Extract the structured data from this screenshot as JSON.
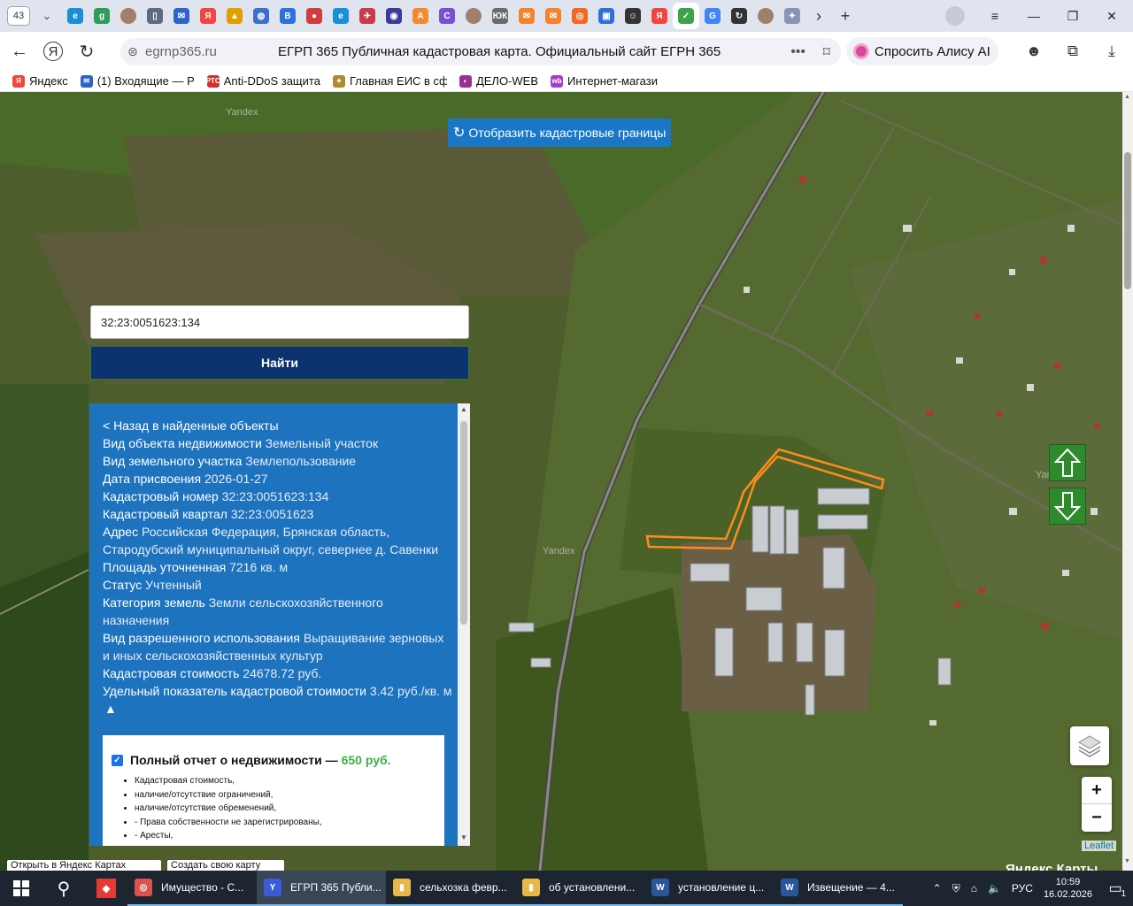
{
  "browser": {
    "tab_count": "43",
    "url_host": "egrnp365.ru",
    "page_title": "ЕГРП 365 Публичная кадастровая карта. Официальный сайт ЕГРН 365",
    "alice_label": "Спросить Алису AI",
    "menu_dots": "•••",
    "tab_favicons": [
      {
        "name": "edge-icon",
        "color": "#1a8fd6",
        "glyph": "e"
      },
      {
        "name": "ok-icon",
        "color": "#2e9c5b",
        "glyph": "g"
      },
      {
        "name": "avatar-icon",
        "color": "#a17f6b",
        "glyph": ""
      },
      {
        "name": "document-icon",
        "color": "#5b6b80",
        "glyph": "▯"
      },
      {
        "name": "mail-icon",
        "color": "#2d62c9",
        "glyph": "✉"
      },
      {
        "name": "yandex-icon",
        "color": "#f2453d",
        "glyph": "Я"
      },
      {
        "name": "game-icon",
        "color": "#e0a100",
        "glyph": "▲"
      },
      {
        "name": "globe-icon",
        "color": "#3d6fc9",
        "glyph": "◍"
      },
      {
        "name": "vk-icon",
        "color": "#2a73d9",
        "glyph": "В"
      },
      {
        "name": "flag-icon",
        "color": "#d23c3c",
        "glyph": "●"
      },
      {
        "name": "edge-icon-2",
        "color": "#1a8fd6",
        "glyph": "e"
      },
      {
        "name": "plane-icon",
        "color": "#c93a4b",
        "glyph": "✈"
      },
      {
        "name": "owl-icon",
        "color": "#3b3c9a",
        "glyph": "◉"
      },
      {
        "name": "a-icon",
        "color": "#f28b2f",
        "glyph": "A"
      },
      {
        "name": "c-icon",
        "color": "#7a4fd3",
        "glyph": "C"
      },
      {
        "name": "avatar-icon-2",
        "color": "#a17f6b",
        "glyph": ""
      },
      {
        "name": "uk-icon",
        "color": "#6b6b6b",
        "glyph": "ЮК"
      },
      {
        "name": "mail-orange-icon",
        "color": "#f2842f",
        "glyph": "✉"
      },
      {
        "name": "mail-orange-icon-2",
        "color": "#f2842f",
        "glyph": "✉"
      },
      {
        "name": "ok-orange-icon",
        "color": "#f26722",
        "glyph": "◎"
      },
      {
        "name": "tasks-icon",
        "color": "#2f6fd6",
        "glyph": "▣"
      },
      {
        "name": "smile-icon",
        "color": "#333333",
        "glyph": "☺"
      },
      {
        "name": "yandex-icon-2",
        "color": "#f2453d",
        "glyph": "Я"
      },
      {
        "name": "check-icon",
        "color": "#3da34a",
        "glyph": "✓",
        "active": true
      },
      {
        "name": "google-icon",
        "color": "#4285f4",
        "glyph": "G"
      },
      {
        "name": "reload-icon",
        "color": "#333333",
        "glyph": "↻"
      },
      {
        "name": "avatar-icon-3",
        "color": "#a17f6b",
        "glyph": ""
      },
      {
        "name": "emblem-icon",
        "color": "#8a93b5",
        "glyph": "✦"
      }
    ]
  },
  "bookmarks": [
    {
      "label": "Яндекс",
      "color": "#f2453d",
      "glyph": "Я"
    },
    {
      "label": "(1) Входящие — Р",
      "color": "#2d62c9",
      "glyph": "✉"
    },
    {
      "label": "Anti-DDoS защита",
      "color": "#d32f2f",
      "glyph": "РТС"
    },
    {
      "label": "Главная ЕИС в сф",
      "color": "#b08a2e",
      "glyph": "✦"
    },
    {
      "label": "ДЕЛО-WEB",
      "color": "#9b2f8f",
      "glyph": "◐"
    },
    {
      "label": "Интернет-магази",
      "color": "#a33fd0",
      "glyph": "wb"
    }
  ],
  "map": {
    "cadastral_button": "Отобразить кадастровые границы",
    "search_value": "32:23:0051623:134",
    "find_button": "Найти",
    "watermark": "Yandex",
    "leaflet": "Leaflet",
    "open_yandex": "Открыть в Яндекс Картах",
    "create_map": "Создать свою карту",
    "yandex_maps_logo": "Яндекс Карты"
  },
  "info": {
    "back_link": "< Назад в найденные объекты",
    "rows": [
      {
        "label": "Вид объекта недвижимости",
        "value": "Земельный участок"
      },
      {
        "label": "Вид земельного участка",
        "value": "Землепользование"
      },
      {
        "label": "Дата присвоения",
        "value": "2026-01-27"
      },
      {
        "label": "Кадастровый номер",
        "value": "32:23:0051623:134"
      },
      {
        "label": "Кадастровый квартал",
        "value": "32:23:0051623"
      },
      {
        "label": "Адрес",
        "value": "Российская Федерация, Брянская область, Стародубский муниципальный округ, севернее д. Савенки"
      },
      {
        "label": "Площадь уточненная",
        "value": "7216 кв. м"
      },
      {
        "label": "Статус",
        "value": "Учтенный"
      },
      {
        "label": "Категория земель",
        "value": "Земли сельскохозяйственного назначения"
      },
      {
        "label": "Вид разрешенного использования",
        "value": "Выращивание зерновых и иных сельскохозяйственных культур"
      },
      {
        "label": "Кадастровая стоимость",
        "value": "24678.72 руб."
      },
      {
        "label": "Удельный показатель кадастровой стоимости",
        "value": "3.42 руб./кв. м"
      }
    ],
    "collapse": "▲",
    "report_title": "Полный отчет о недвижимости —",
    "report_price": "650 руб.",
    "report_items": [
      "Кадастровая стоимость,",
      "наличие/отсутствие ограничений,",
      "наличие/отсутствие обременений,",
      "- Права собственности не зарегистрированы,",
      "- Аресты,"
    ]
  },
  "taskbar": {
    "items": [
      {
        "label": "Имущество - С...",
        "icon_color": "#d9534f",
        "glyph": "◎"
      },
      {
        "label": "ЕГРП 365 Публи...",
        "icon_color": "#3b5bdb",
        "glyph": "Y",
        "active": true
      },
      {
        "label": "сельхозка февр...",
        "icon_color": "#e8b84a",
        "glyph": "▮"
      },
      {
        "label": "об установлени...",
        "icon_color": "#e8b84a",
        "glyph": "▮"
      },
      {
        "label": "установление ц...",
        "icon_color": "#2b579a",
        "glyph": "W"
      },
      {
        "label": "Извещение — 4...",
        "icon_color": "#2b579a",
        "glyph": "W"
      }
    ],
    "lang": "РУС",
    "time": "10:59",
    "date": "16.02.2026",
    "notif_count": "1"
  }
}
